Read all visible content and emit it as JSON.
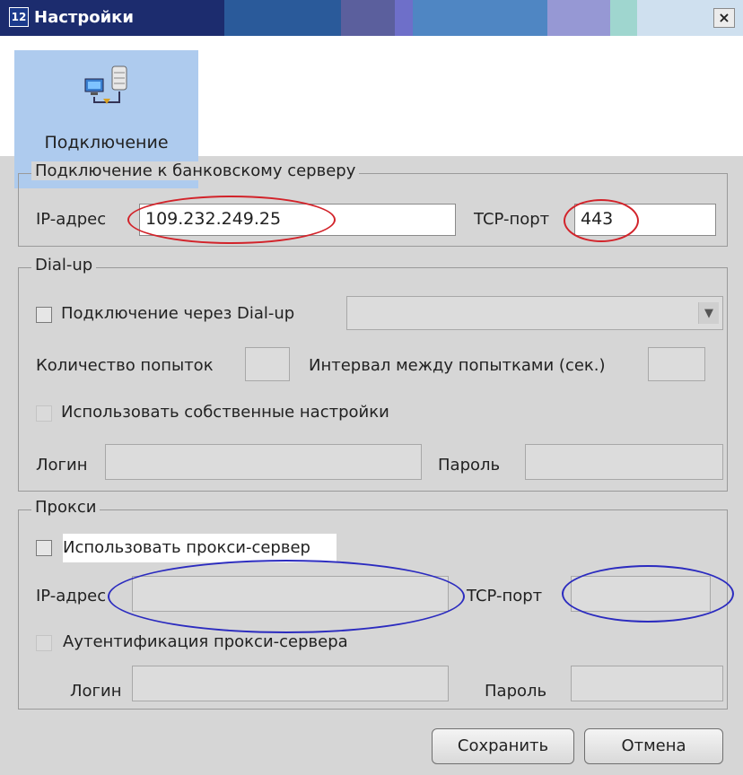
{
  "window": {
    "title": "Настройки",
    "close_glyph": "×",
    "app_icon": "app-icon"
  },
  "toolbar": {
    "connection_label": "Подключение",
    "connection_icon": "network-connection-icon"
  },
  "bank_server": {
    "legend": "Подключение к банковскому серверу",
    "ip_label": "IP-адрес",
    "ip_value": "109.232.249.25",
    "port_label": "TCP-порт",
    "port_value": "443"
  },
  "dialup": {
    "legend": "Dial-up",
    "use_dialup_label": "Подключение через Dial-up",
    "use_dialup_checked": false,
    "connection_select_value": "",
    "attempts_label": "Количество попыток",
    "attempts_value": "",
    "interval_label": "Интервал между попытками (сек.)",
    "interval_value": "",
    "own_settings_label": "Использовать собственные настройки",
    "login_label": "Логин",
    "login_value": "",
    "password_label": "Пароль",
    "password_value": ""
  },
  "proxy": {
    "legend": "Прокси",
    "use_proxy_label": "Использовать прокси-сервер",
    "use_proxy_checked": false,
    "ip_label": "IP-адрес",
    "ip_value": "",
    "port_label": "TCP-порт",
    "port_value": "",
    "auth_label": "Аутентификация прокси-сервера",
    "login_label": "Логин",
    "login_value": "",
    "password_label": "Пароль",
    "password_value": ""
  },
  "buttons": {
    "save": "Сохранить",
    "cancel": "Отмена"
  },
  "annotations": {
    "bank_server_color": "#d2232a",
    "proxy_color": "#2b2bbf"
  }
}
